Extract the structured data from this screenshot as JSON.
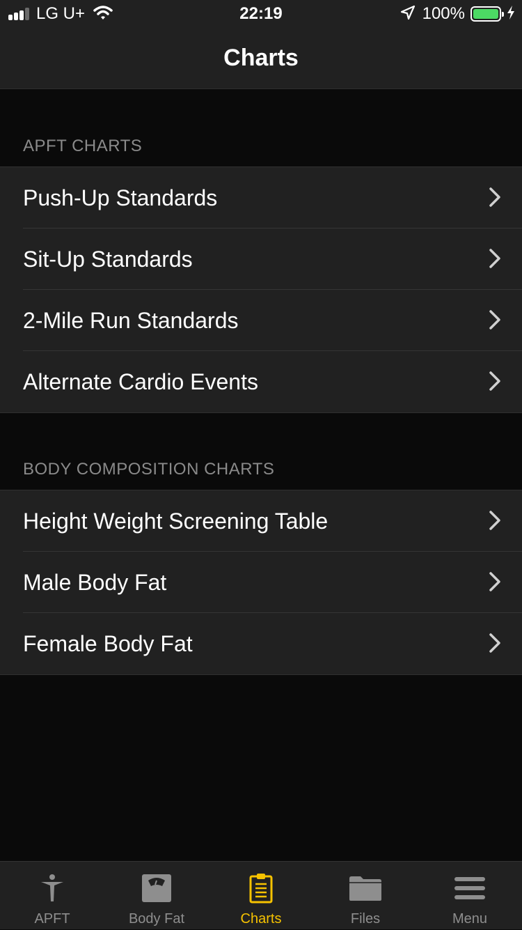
{
  "status_bar": {
    "carrier": "LG U+",
    "time": "22:19",
    "battery_percent": "100%",
    "battery_color": "#4cd964",
    "signal_bars_filled": 3,
    "signal_bars_total": 4
  },
  "nav": {
    "title": "Charts"
  },
  "sections": [
    {
      "header": "APFT CHARTS",
      "items": [
        {
          "label": "Push-Up Standards"
        },
        {
          "label": "Sit-Up Standards"
        },
        {
          "label": "2-Mile Run Standards"
        },
        {
          "label": "Alternate Cardio Events"
        }
      ]
    },
    {
      "header": "BODY COMPOSITION CHARTS",
      "items": [
        {
          "label": "Height Weight Screening Table"
        },
        {
          "label": "Male Body Fat"
        },
        {
          "label": "Female Body Fat"
        }
      ]
    }
  ],
  "tab_bar": {
    "accent_color": "#f6c200",
    "tabs": [
      {
        "label": "APFT",
        "icon": "person-icon"
      },
      {
        "label": "Body Fat",
        "icon": "scale-icon"
      },
      {
        "label": "Charts",
        "icon": "clipboard-icon",
        "active": true
      },
      {
        "label": "Files",
        "icon": "folder-icon"
      },
      {
        "label": "Menu",
        "icon": "menu-icon"
      }
    ]
  }
}
